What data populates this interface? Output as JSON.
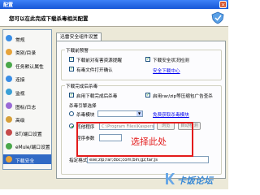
{
  "window": {
    "title": "配置",
    "header": "您可以在此完成下载杀毒相关配置"
  },
  "sidebar": {
    "items": [
      {
        "label": "常规",
        "color": "#3a8ee6"
      },
      {
        "label": "类别/目录",
        "color": "#e6a33a"
      },
      {
        "label": "任务默认属性",
        "color": "#4aa84a"
      },
      {
        "label": "连接",
        "color": "#3a8ee6"
      },
      {
        "label": "监视",
        "color": "#3aa0d6"
      },
      {
        "label": "图标/日志",
        "color": "#9a6ad6"
      },
      {
        "label": "高级",
        "color": "#d6a03a"
      },
      {
        "label": "BT/端口设置",
        "color": "#c64a4a"
      },
      {
        "label": "eMule/端口设置",
        "color": "#4aa84a"
      },
      {
        "label": "下载安全",
        "color": "#e6a33a"
      }
    ],
    "active_index": 9
  },
  "tab": {
    "label": "迅雷安全组件设置"
  },
  "prevention": {
    "title": "下载前预警",
    "items": [
      {
        "label": "下载前对有害资源提醒",
        "checked": true
      },
      {
        "label": "下载安全状况检测",
        "checked": true
      },
      {
        "label": "有毒文件打开确认",
        "checked": true
      }
    ],
    "link": "安全下载中心"
  },
  "post_download": {
    "title": "下载完成后杀毒",
    "items": [
      {
        "label": "启用下载完成后杀毒",
        "checked": true
      },
      {
        "label": "启用rar/zip等压缩包广告查杀",
        "checked": true
      }
    ],
    "engine_label": "杀毒引擎选择",
    "engine_radio": "杀毒模块",
    "engine_value": "",
    "free_link": "免费获取杀毒模块",
    "other_radio": "其他程序",
    "other_path": "C:\\Program Files\\Kaspersk",
    "browse_button": "浏览",
    "auto_detect_button": "自动检测",
    "params_label": "程序参数",
    "ext_label": "指定格式",
    "ext_value": "exe;zip;rar;doc;com;bin;gz;tar;js"
  },
  "annotation": "选择此处",
  "watermark": "卡饭论坛"
}
